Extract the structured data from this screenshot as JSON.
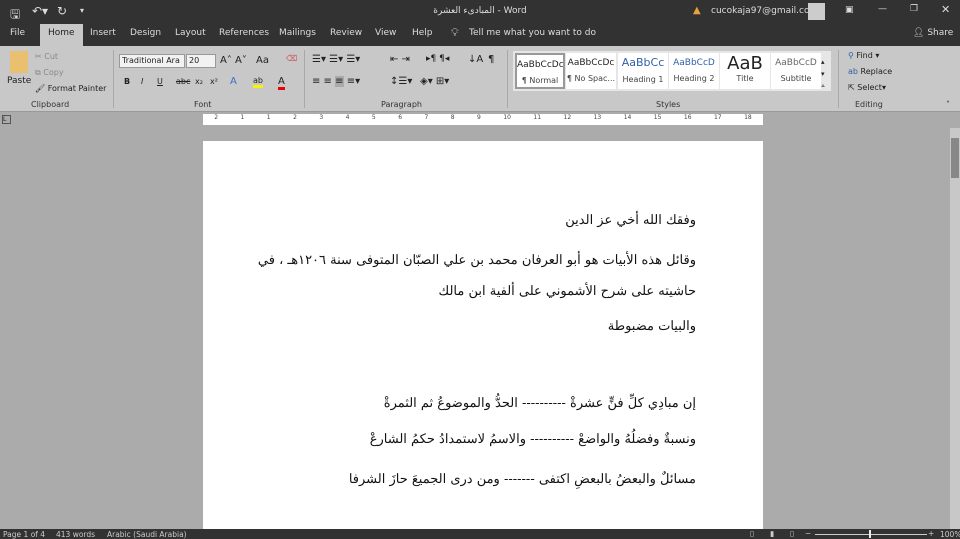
{
  "window": {
    "title": "المبادىء العشرة - Word",
    "account": "cucokaja97@gmail.com"
  },
  "quick_access": {
    "save": "save-icon",
    "undo": "undo-icon",
    "redo": "redo-icon"
  },
  "tabs": [
    "File",
    "Home",
    "Insert",
    "Design",
    "Layout",
    "References",
    "Mailings",
    "Review",
    "View",
    "Help"
  ],
  "tell_me": "Tell me what you want to do",
  "share": "Share",
  "clipboard": {
    "paste": "Paste",
    "cut": "Cut",
    "copy": "Copy",
    "format_painter": "Format Painter",
    "label": "Clipboard"
  },
  "font": {
    "name": "Traditional Ara",
    "size": "20",
    "label": "Font",
    "bold": "B",
    "italic": "I",
    "underline": "U",
    "strike": "abc",
    "sub": "x₂",
    "sup": "x²",
    "case": "Aa"
  },
  "paragraph": {
    "label": "Paragraph"
  },
  "styles": {
    "label": "Styles",
    "items": [
      {
        "preview": "AaBbCcDc",
        "name": "¶ Normal"
      },
      {
        "preview": "AaBbCcDc",
        "name": "¶ No Spac..."
      },
      {
        "preview": "AaBbCc",
        "name": "Heading 1"
      },
      {
        "preview": "AaBbCcD",
        "name": "Heading 2"
      },
      {
        "preview": "AaB",
        "name": "Title"
      },
      {
        "preview": "AaBbCcD",
        "name": "Subtitle"
      }
    ]
  },
  "editing": {
    "find": "Find",
    "replace": "Replace",
    "select": "Select",
    "label": "Editing"
  },
  "ruler": [
    "2",
    "1",
    "1",
    "2",
    "3",
    "4",
    "5",
    "6",
    "7",
    "8",
    "9",
    "10",
    "11",
    "12",
    "13",
    "14",
    "15",
    "16",
    "17",
    "18"
  ],
  "document": {
    "lines": [
      "وفقك الله أخي عز الدين",
      "وقائل هذه الأبيات هو أبو العرفان محمد بن علي الصبّان المتوفى سنة ١٢٠٦هـ ، في",
      "حاشيته على شرح الأشموني على ألفية ابن مالك",
      "والبيات مضبوطة",
      "إن مبادِي كلِّ فنٍّ عشرةْ ---------- الحدُّ والموضوعُ ثم الثمرةْ",
      "ونسبةٌ وفضلُهُ والواضعْ ---------- والاسمُ لاستمدادُ حكمُ الشارعْ",
      "مسائلٌ والبعضُ بالبعضِ اكتفى ------- ومن درى الجميعَ حازَ الشرفا"
    ]
  },
  "status": {
    "page": "Page 1 of 4",
    "words": "413 words",
    "language": "Arabic (Saudi Arabia)",
    "zoom": "100%"
  }
}
